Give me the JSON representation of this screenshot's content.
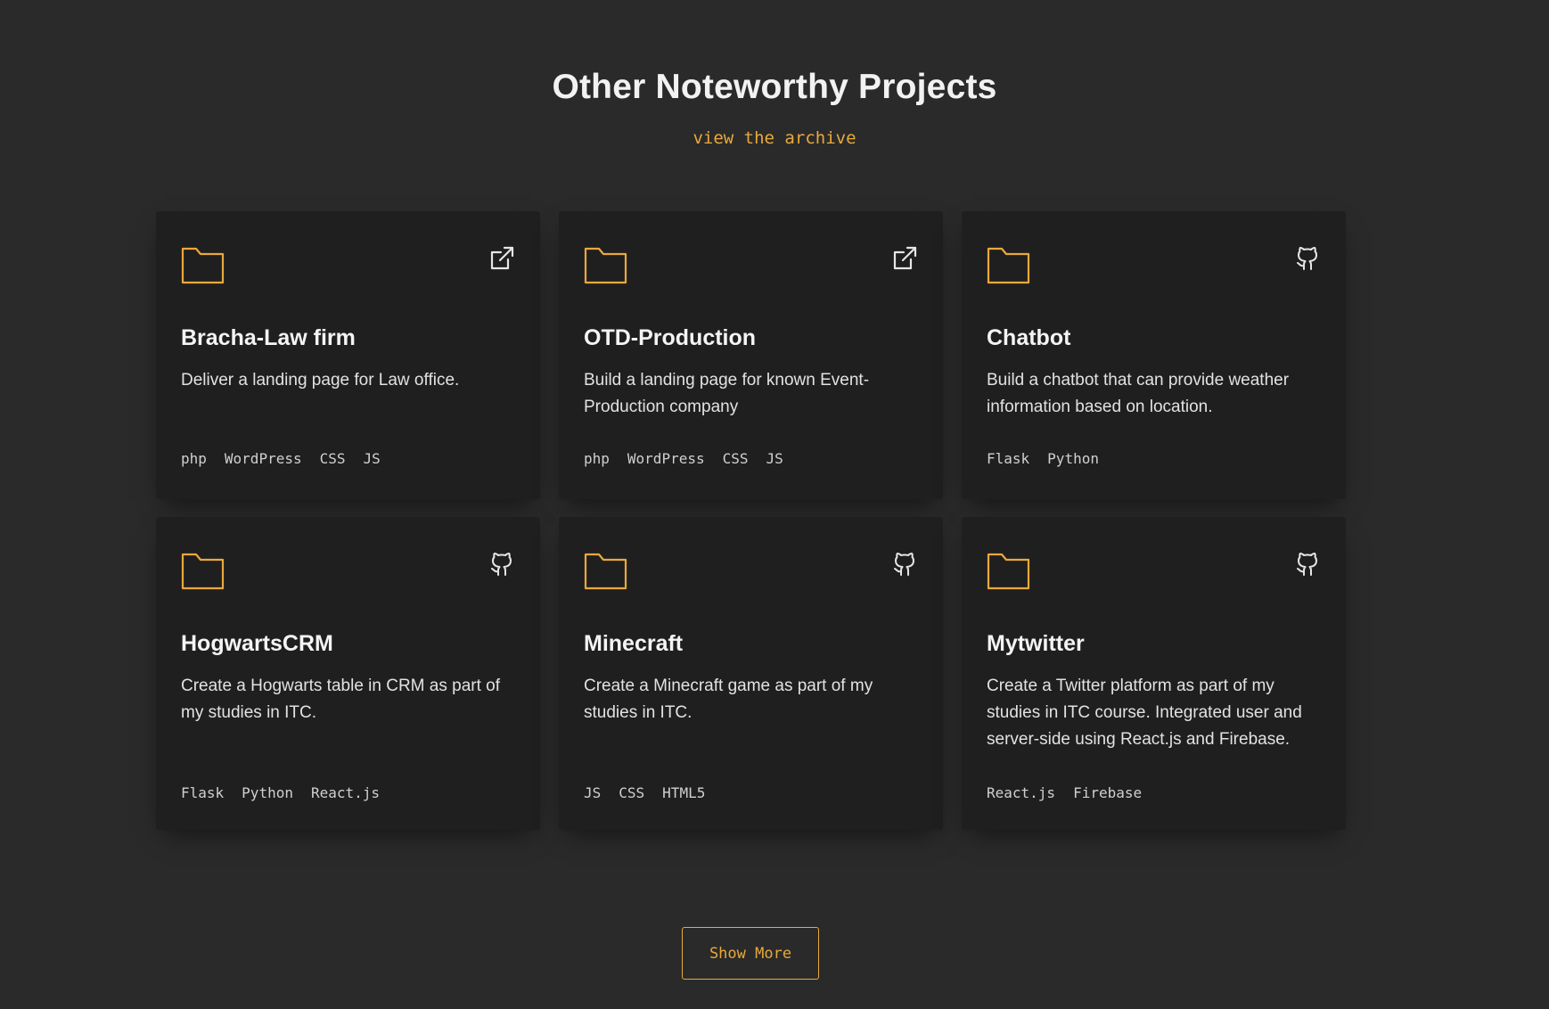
{
  "section": {
    "title": "Other Noteworthy Projects",
    "archive_link": "view the archive",
    "show_more_label": "Show More"
  },
  "colors": {
    "background": "#2a2a2a",
    "card_background": "#201f20",
    "accent": "#e8a93c",
    "text": "#e6e6e6"
  },
  "projects": [
    {
      "title": "Bracha-Law firm",
      "description": "Deliver a landing page for Law office.",
      "tags": [
        "php",
        "WordPress",
        "CSS",
        "JS"
      ],
      "link_icon": "external-link-icon"
    },
    {
      "title": "OTD-Production",
      "description": "Build a landing page for known Event-Production company",
      "tags": [
        "php",
        "WordPress",
        "CSS",
        "JS"
      ],
      "link_icon": "external-link-icon"
    },
    {
      "title": "Chatbot",
      "description": "Build a chatbot that can provide weather information based on location.",
      "tags": [
        "Flask",
        "Python"
      ],
      "link_icon": "github-icon"
    },
    {
      "title": "HogwartsCRM",
      "description": "Create a Hogwarts table in CRM as part of my studies in ITC.",
      "tags": [
        "Flask",
        "Python",
        "React.js"
      ],
      "link_icon": "github-icon"
    },
    {
      "title": "Minecraft",
      "description": "Create a Minecraft game as part of my studies in ITC.",
      "tags": [
        "JS",
        "CSS",
        "HTML5"
      ],
      "link_icon": "github-icon"
    },
    {
      "title": "Mytwitter",
      "description": "Create a Twitter platform as part of my studies in ITC course. Integrated user and server-side using React.js and Firebase.",
      "tags": [
        "React.js",
        "Firebase"
      ],
      "link_icon": "github-icon"
    }
  ]
}
